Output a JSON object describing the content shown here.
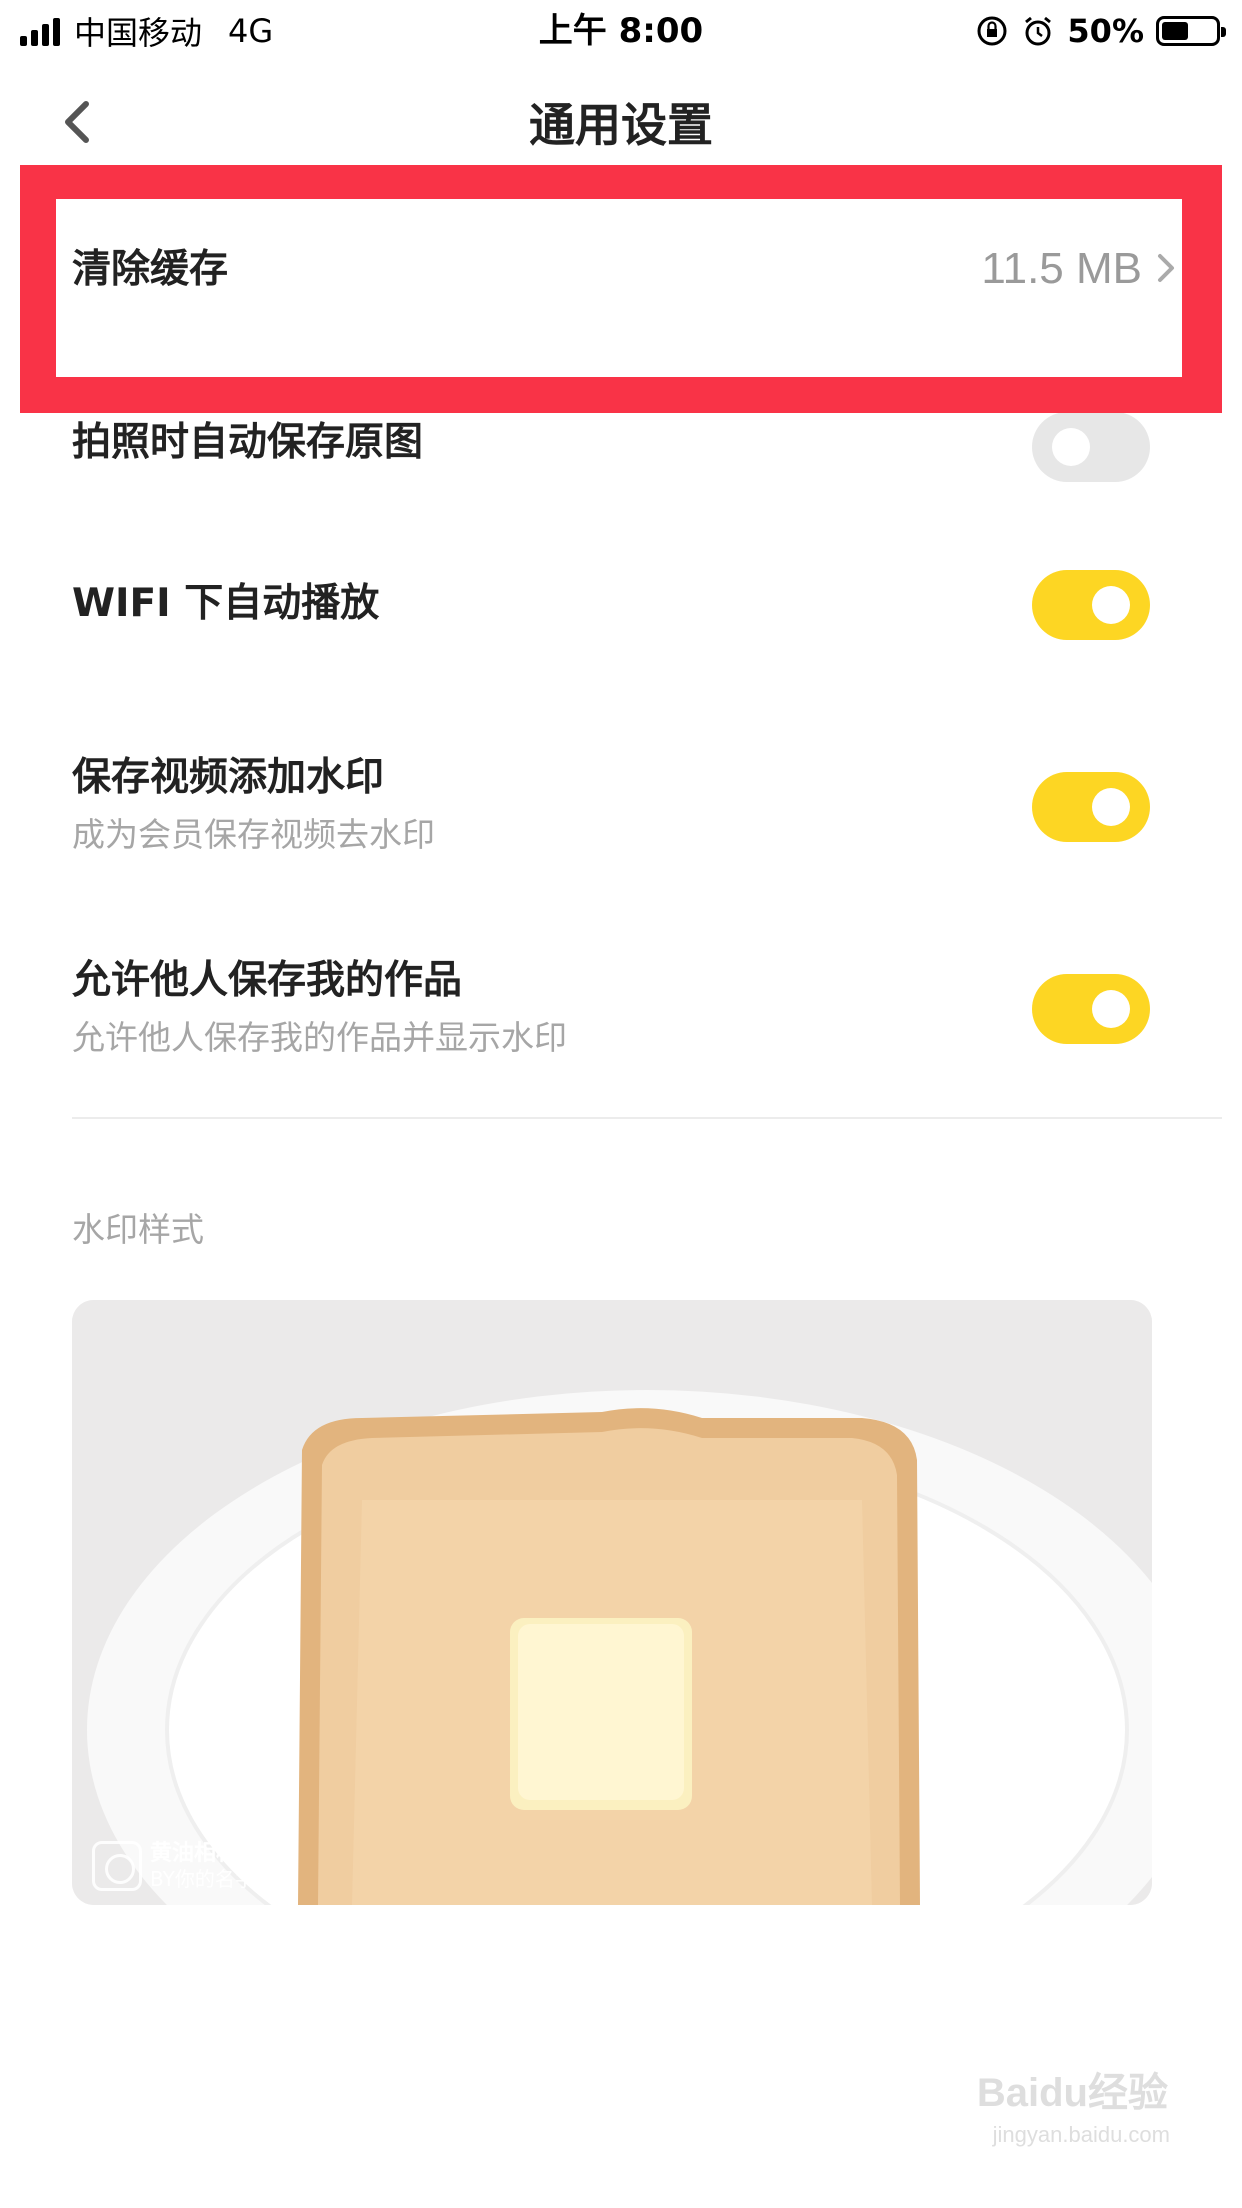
{
  "status_bar": {
    "carrier": "中国移动",
    "network": "4G",
    "time": "上午 8:00",
    "battery_percent": "50%",
    "battery_level": 0.5,
    "icons": [
      "signal-icon",
      "rotation-lock-icon",
      "alarm-icon",
      "battery-icon"
    ]
  },
  "nav": {
    "title": "通用设置",
    "back_icon": "chevron-left-icon"
  },
  "settings": {
    "clear_cache": {
      "label": "清除缓存",
      "value": "11.5 MB"
    },
    "auto_save_original": {
      "label": "拍照时自动保存原图",
      "enabled": false
    },
    "wifi_autoplay": {
      "label": "WIFI 下自动播放",
      "enabled": true
    },
    "video_watermark": {
      "label": "保存视频添加水印",
      "sublabel": "成为会员保存视频去水印",
      "enabled": true
    },
    "allow_save": {
      "label": "允许他人保存我的作品",
      "sublabel": "允许他人保存我的作品并显示水印",
      "enabled": true
    }
  },
  "watermark_section": {
    "label": "水印样式",
    "preview_brand": "黄油相机",
    "preview_by": "BY你的名字"
  },
  "overlay": {
    "highlight_color": "#f93347",
    "accent_color": "#fdd623",
    "site_watermark": "Baidu经验",
    "site_url": "jingyan.baidu.com"
  }
}
